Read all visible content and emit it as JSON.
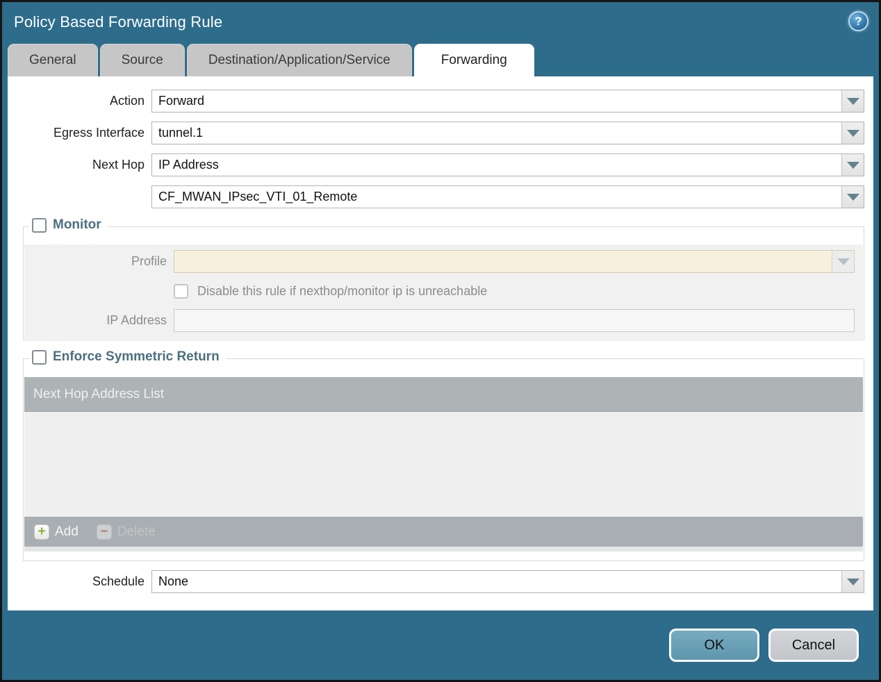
{
  "dialog": {
    "title": "Policy Based Forwarding Rule",
    "help_glyph": "?"
  },
  "tabs": [
    {
      "label": "General",
      "active": false
    },
    {
      "label": "Source",
      "active": false
    },
    {
      "label": "Destination/Application/Service",
      "active": false
    },
    {
      "label": "Forwarding",
      "active": true
    }
  ],
  "form": {
    "action": {
      "label": "Action",
      "value": "Forward"
    },
    "egress_interface": {
      "label": "Egress Interface",
      "value": "tunnel.1"
    },
    "next_hop": {
      "label": "Next Hop",
      "value": "IP Address"
    },
    "next_hop_address": {
      "value": "CF_MWAN_IPsec_VTI_01_Remote"
    },
    "schedule": {
      "label": "Schedule",
      "value": "None"
    }
  },
  "monitor": {
    "legend": "Monitor",
    "checked": false,
    "profile": {
      "label": "Profile",
      "value": ""
    },
    "disable_rule": {
      "label": "Disable this rule if nexthop/monitor ip is unreachable",
      "checked": false
    },
    "ip_address": {
      "label": "IP Address",
      "value": ""
    }
  },
  "symmetric_return": {
    "legend": "Enforce Symmetric Return",
    "checked": false,
    "table_header": "Next Hop Address List",
    "rows": [],
    "add_label": "Add",
    "add_glyph": "+",
    "delete_label": "Delete",
    "delete_glyph": "−",
    "delete_enabled": false
  },
  "footer": {
    "ok_label": "OK",
    "cancel_label": "Cancel"
  },
  "colors": {
    "chrome_teal": "#2d6c8b",
    "active_tab_bg": "#ffffff",
    "inactive_tab_bg": "#c6c6c6",
    "legend_text": "#4c6f80",
    "profile_field_bg": "#f6f0dc",
    "table_header_bg": "#aeb3b6",
    "table_body_bg": "#efefef",
    "ok_button_bg": "#69a1b8",
    "cancel_button_bg": "#c9cccf",
    "add_plus_green": "#8fae3d",
    "delete_minus_red": "#b2705f",
    "dropdown_arrow": "#66818e"
  }
}
